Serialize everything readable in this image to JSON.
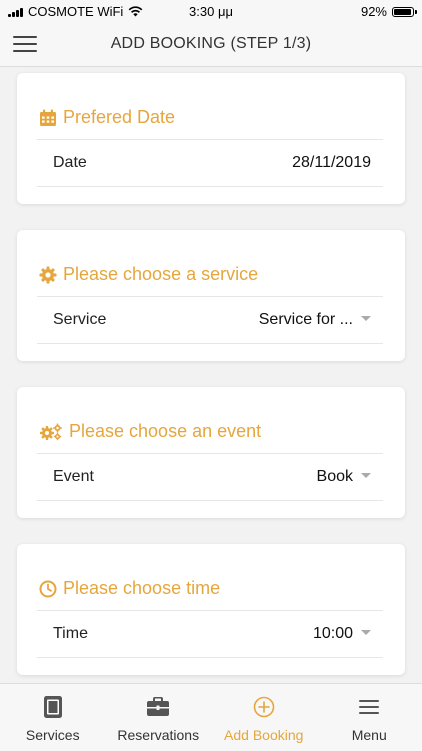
{
  "status_bar": {
    "carrier": "COSMOTE WiFi",
    "time": "3:30 μμ",
    "battery": "92%",
    "battery_level": 0.92
  },
  "header": {
    "title": "ADD BOOKING (STEP 1/3)",
    "menu_icon": "hamburger-icon"
  },
  "colors": {
    "accent": "#e5a63d",
    "background": "#f2f2f2",
    "card": "#ffffff"
  },
  "cards": {
    "date": {
      "icon": "calendar-icon",
      "title": "Prefered Date",
      "label": "Date",
      "value": "28/11/2019"
    },
    "service": {
      "icon": "gear-icon",
      "title": "Please choose a service",
      "label": "Service",
      "value": "Service for ..."
    },
    "event": {
      "icon": "gears-icon",
      "title": "Please choose an event",
      "label": "Event",
      "value": "Book"
    },
    "time": {
      "icon": "clock-icon",
      "title": "Please choose time",
      "label": "Time",
      "value": "10:00"
    }
  },
  "tabs": [
    {
      "label": "Services",
      "icon": "services-icon"
    },
    {
      "label": "Reservations",
      "icon": "briefcase-icon"
    },
    {
      "label": "Add Booking",
      "icon": "plus-circle-icon",
      "active": true
    },
    {
      "label": "Menu",
      "icon": "menu-icon"
    }
  ]
}
